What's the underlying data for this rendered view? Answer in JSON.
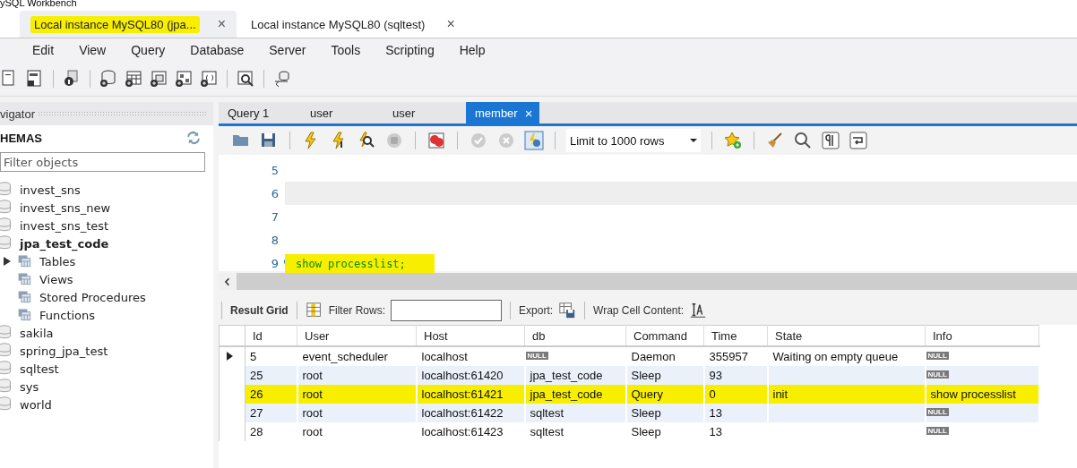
{
  "app_title": "ySQL Workbench",
  "connection_tabs": [
    {
      "label": "Local instance MySQL80 (jpa...",
      "selected": true,
      "highlighted": true,
      "close": "×"
    },
    {
      "label": "Local instance MySQL80 (sqltest)",
      "selected": false,
      "highlighted": false,
      "close": "×"
    }
  ],
  "menu": [
    "Edit",
    "View",
    "Query",
    "Database",
    "Server",
    "Tools",
    "Scripting",
    "Help"
  ],
  "navigator": {
    "title": "vigator",
    "section": "HEMAS",
    "filter": {
      "placeholder": "Filter objects"
    },
    "schemas": [
      {
        "name": "invest_sns",
        "default": false
      },
      {
        "name": "invest_sns_new",
        "default": false
      },
      {
        "name": "invest_sns_test",
        "default": false
      },
      {
        "name": "jpa_test_code",
        "default": true,
        "children": [
          {
            "name": "Tables",
            "has_arrow": true
          },
          {
            "name": "Views",
            "has_arrow": false
          },
          {
            "name": "Stored Procedures",
            "has_arrow": false
          },
          {
            "name": "Functions",
            "has_arrow": false
          }
        ]
      },
      {
        "name": "sakila",
        "default": false
      },
      {
        "name": "spring_jpa_test",
        "default": false
      },
      {
        "name": "sqltest",
        "default": false
      },
      {
        "name": "sys",
        "default": false
      },
      {
        "name": "world",
        "default": false
      }
    ]
  },
  "query_tabs": [
    {
      "label": "Query 1",
      "selected": false
    },
    {
      "label": "user",
      "selected": false
    },
    {
      "label": "user",
      "selected": false
    },
    {
      "label": "member",
      "selected": true,
      "close": "×"
    }
  ],
  "limit": "Limit to 1000 rows",
  "editor": {
    "lines": [
      {
        "number": "5"
      },
      {
        "number": "6",
        "current": true
      },
      {
        "number": "7"
      },
      {
        "number": "8"
      },
      {
        "number": "9",
        "code": "show processlist;",
        "dot": true,
        "highlighted": true
      }
    ]
  },
  "result_toolbar": {
    "result_grid": "Result Grid",
    "filter_label": "Filter Rows:",
    "export_label": "Export:",
    "wrap_label": "Wrap Cell Content:"
  },
  "table": {
    "columns": [
      "Id",
      "User",
      "Host",
      "db",
      "Command",
      "Time",
      "State",
      "Info"
    ],
    "rows": [
      {
        "current": true,
        "highlighted": false,
        "cells": [
          "5",
          "event_scheduler",
          "localhost",
          {
            "kind": "null",
            "text": "NULL"
          },
          "Daemon",
          "355957",
          "Waiting on empty queue",
          {
            "kind": "null",
            "text": "NULL"
          }
        ]
      },
      {
        "current": false,
        "highlighted": false,
        "cells": [
          "25",
          "root",
          "localhost:61420",
          "jpa_test_code",
          "Sleep",
          "93",
          "",
          {
            "kind": "null",
            "text": "NULL"
          }
        ]
      },
      {
        "current": false,
        "highlighted": true,
        "cells": [
          "26",
          "root",
          "localhost:61421",
          "jpa_test_code",
          "Query",
          "0",
          "init",
          "show processlist"
        ]
      },
      {
        "current": false,
        "highlighted": false,
        "cells": [
          "27",
          "root",
          "localhost:61422",
          "sqltest",
          "Sleep",
          "13",
          "",
          {
            "kind": "null",
            "text": "NULL"
          }
        ]
      },
      {
        "current": false,
        "highlighted": false,
        "cells": [
          "28",
          "root",
          "localhost:61423",
          "sqltest",
          "Sleep",
          "13",
          "",
          {
            "kind": "null",
            "text": "NULL"
          }
        ]
      }
    ]
  }
}
